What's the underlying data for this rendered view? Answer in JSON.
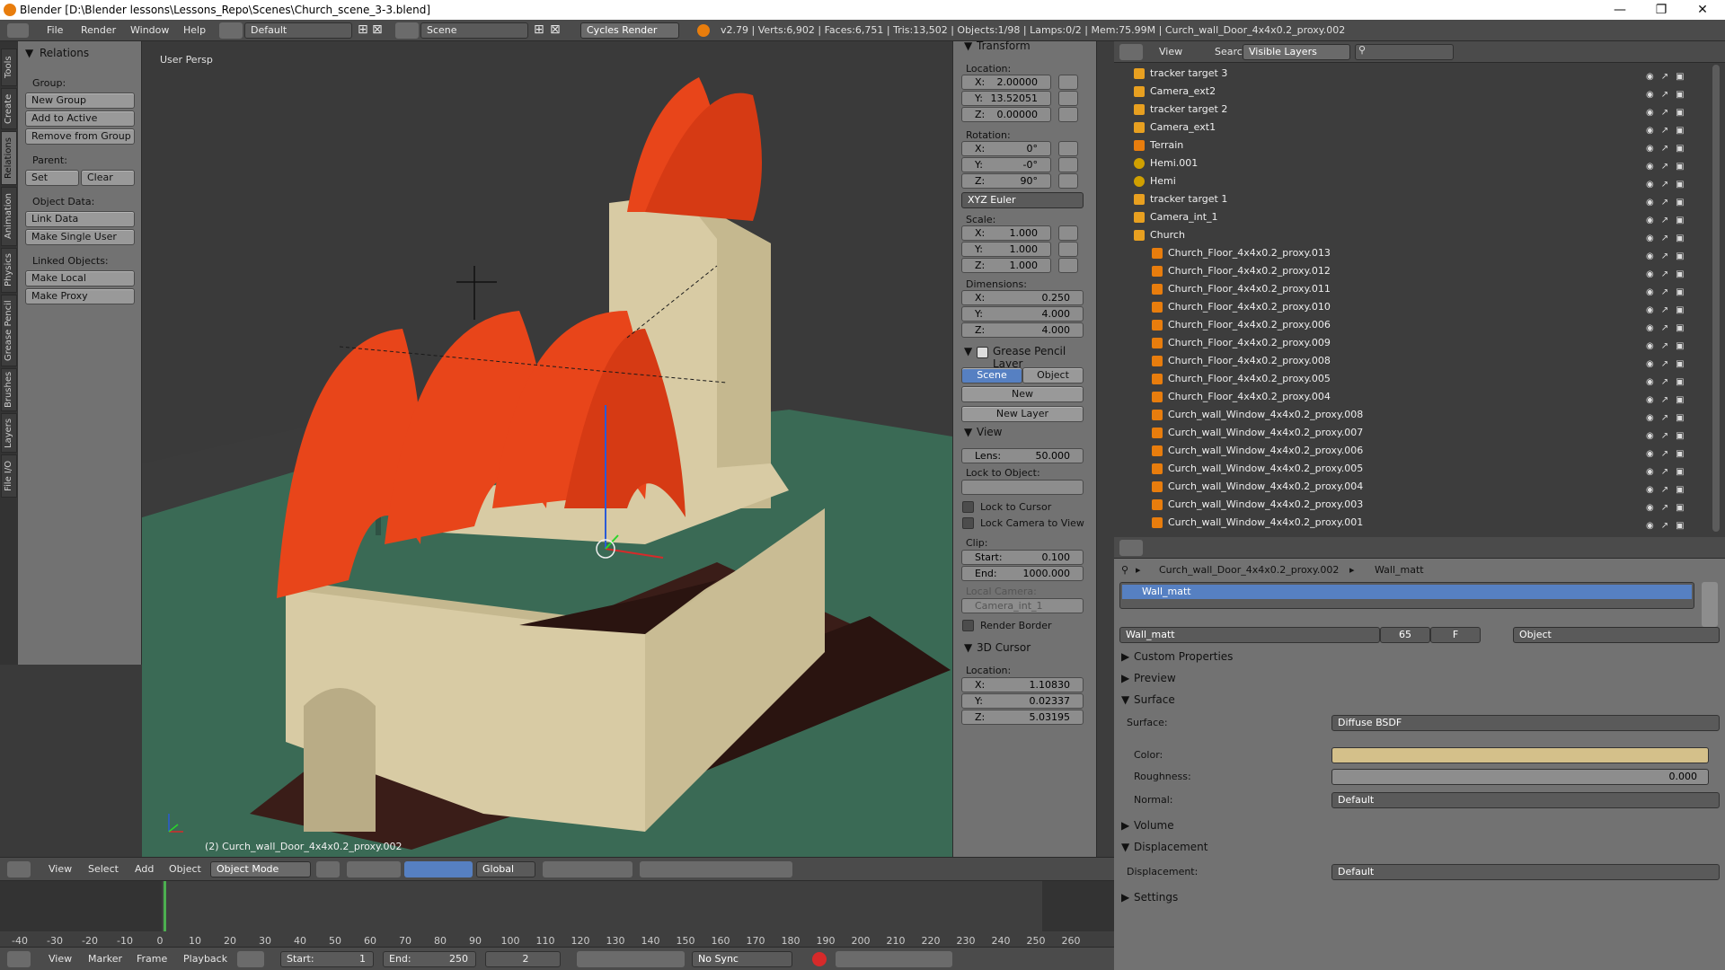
{
  "window": {
    "title": "Blender [D:\\Blender lessons\\Lessons_Repo\\Scenes\\Church_scene_3-3.blend]",
    "controls": [
      "—",
      "❐",
      "✕"
    ]
  },
  "infobar": {
    "menus": [
      "File",
      "Render",
      "Window",
      "Help"
    ],
    "layout": "Default",
    "scene": "Scene",
    "engine": "Cycles Render",
    "stats": "v2.79 | Verts:6,902 | Faces:6,751 | Tris:13,502 | Objects:1/98 | Lamps:0/2 | Mem:75.99M | Curch_wall_Door_4x4x0.2_proxy.002"
  },
  "left_tabs": [
    "Tools",
    "Create",
    "Relations",
    "Animation",
    "Physics",
    "Grease Pencil",
    "Brushes",
    "Layers",
    "File I/O"
  ],
  "toolshelf": {
    "title": "Relations",
    "group_label": "Group:",
    "new_group": "New Group",
    "add_to_active": "Add to Active",
    "remove_from_group": "Remove from Group",
    "parent_label": "Parent:",
    "set": "Set",
    "clear": "Clear",
    "object_data_label": "Object Data:",
    "link_data": "Link Data",
    "make_single_user": "Make Single User",
    "linked_objects_label": "Linked Objects:",
    "make_local": "Make Local",
    "make_proxy": "Make Proxy"
  },
  "viewport": {
    "persp_label": "User Persp",
    "active_object": "(2) Curch_wall_Door_4x4x0.2_proxy.002"
  },
  "npanel": {
    "transform_title": "Transform",
    "location_label": "Location:",
    "location": [
      {
        "k": "X:",
        "v": "2.00000"
      },
      {
        "k": "Y:",
        "v": "13.52051"
      },
      {
        "k": "Z:",
        "v": "0.00000"
      }
    ],
    "rotation_label": "Rotation:",
    "rotation": [
      {
        "k": "X:",
        "v": "0°"
      },
      {
        "k": "Y:",
        "v": "-0°"
      },
      {
        "k": "Z:",
        "v": "90°"
      }
    ],
    "rotation_mode": "XYZ Euler",
    "scale_label": "Scale:",
    "scale": [
      {
        "k": "X:",
        "v": "1.000"
      },
      {
        "k": "Y:",
        "v": "1.000"
      },
      {
        "k": "Z:",
        "v": "1.000"
      }
    ],
    "dimensions_label": "Dimensions:",
    "dimensions": [
      {
        "k": "X:",
        "v": "0.250"
      },
      {
        "k": "Y:",
        "v": "4.000"
      },
      {
        "k": "Z:",
        "v": "4.000"
      }
    ],
    "grease_pencil_title": "Grease Pencil Layer",
    "gp_scene": "Scene",
    "gp_object": "Object",
    "gp_new": "New",
    "gp_new_layer": "New Layer",
    "view_title": "View",
    "lens_label": "Lens:",
    "lens_value": "50.000",
    "lock_to_object_label": "Lock to Object:",
    "lock_to_cursor": "Lock to Cursor",
    "lock_camera_to_view": "Lock Camera to View",
    "clip_label": "Clip:",
    "clip_start_label": "Start:",
    "clip_start": "0.100",
    "clip_end_label": "End:",
    "clip_end": "1000.000",
    "local_camera_label": "Local Camera:",
    "local_camera": "Camera_int_1",
    "render_border": "Render Border",
    "cursor_title": "3D Cursor",
    "cursor_location_label": "Location:",
    "cursor": [
      {
        "k": "X:",
        "v": "1.10830"
      },
      {
        "k": "Y:",
        "v": "0.02337"
      },
      {
        "k": "Z:",
        "v": "5.03195"
      }
    ]
  },
  "outliner": {
    "view": "View",
    "search": "Search",
    "filter": "Visible Layers",
    "rows": [
      {
        "name": "tracker target 3",
        "indent": 0,
        "type": "empty"
      },
      {
        "name": "Camera_ext2",
        "indent": 0,
        "type": "camera"
      },
      {
        "name": "tracker target 2",
        "indent": 0,
        "type": "empty"
      },
      {
        "name": "Camera_ext1",
        "indent": 0,
        "type": "camera"
      },
      {
        "name": "Terrain",
        "indent": 0,
        "type": "mesh"
      },
      {
        "name": "Hemi.001",
        "indent": 0,
        "type": "lamp"
      },
      {
        "name": "Hemi",
        "indent": 0,
        "type": "lamp"
      },
      {
        "name": "tracker target 1",
        "indent": 0,
        "type": "empty"
      },
      {
        "name": "Camera_int_1",
        "indent": 0,
        "type": "camera"
      },
      {
        "name": "Church",
        "indent": 0,
        "type": "empty"
      },
      {
        "name": "Church_Floor_4x4x0.2_proxy.013",
        "indent": 1,
        "type": "mesh"
      },
      {
        "name": "Church_Floor_4x4x0.2_proxy.012",
        "indent": 1,
        "type": "mesh"
      },
      {
        "name": "Church_Floor_4x4x0.2_proxy.011",
        "indent": 1,
        "type": "mesh"
      },
      {
        "name": "Church_Floor_4x4x0.2_proxy.010",
        "indent": 1,
        "type": "mesh"
      },
      {
        "name": "Church_Floor_4x4x0.2_proxy.006",
        "indent": 1,
        "type": "mesh"
      },
      {
        "name": "Church_Floor_4x4x0.2_proxy.009",
        "indent": 1,
        "type": "mesh"
      },
      {
        "name": "Church_Floor_4x4x0.2_proxy.008",
        "indent": 1,
        "type": "mesh"
      },
      {
        "name": "Church_Floor_4x4x0.2_proxy.005",
        "indent": 1,
        "type": "mesh"
      },
      {
        "name": "Church_Floor_4x4x0.2_proxy.004",
        "indent": 1,
        "type": "mesh"
      },
      {
        "name": "Curch_wall_Window_4x4x0.2_proxy.008",
        "indent": 1,
        "type": "mesh"
      },
      {
        "name": "Curch_wall_Window_4x4x0.2_proxy.007",
        "indent": 1,
        "type": "mesh"
      },
      {
        "name": "Curch_wall_Window_4x4x0.2_proxy.006",
        "indent": 1,
        "type": "mesh"
      },
      {
        "name": "Curch_wall_Window_4x4x0.2_proxy.005",
        "indent": 1,
        "type": "mesh"
      },
      {
        "name": "Curch_wall_Window_4x4x0.2_proxy.004",
        "indent": 1,
        "type": "mesh"
      },
      {
        "name": "Curch_wall_Window_4x4x0.2_proxy.003",
        "indent": 1,
        "type": "mesh"
      },
      {
        "name": "Curch_wall_Window_4x4x0.2_proxy.001",
        "indent": 1,
        "type": "mesh"
      }
    ]
  },
  "properties": {
    "breadcrumb_object": "Curch_wall_Door_4x4x0.2_proxy.002",
    "breadcrumb_material": "Wall_matt",
    "slot_name": "Wall_matt",
    "material_name": "Wall_matt",
    "users": "65",
    "fake_user": "F",
    "link": "Object",
    "custom_properties": "Custom Properties",
    "preview": "Preview",
    "surface_title": "Surface",
    "surface_label": "Surface:",
    "surface_value": "Diffuse BSDF",
    "color_label": "Color:",
    "color_value": "#d4c08a",
    "roughness_label": "Roughness:",
    "roughness_value": "0.000",
    "normal_label": "Normal:",
    "normal_value": "Default",
    "volume": "Volume",
    "displacement_title": "Displacement",
    "displacement_label": "Displacement:",
    "displacement_value": "Default",
    "settings": "Settings"
  },
  "viewport_header": {
    "menus": [
      "View",
      "Select",
      "Add",
      "Object"
    ],
    "mode": "Object Mode",
    "orientation": "Global"
  },
  "timeline": {
    "ticks": [
      "-40",
      "-30",
      "-20",
      "-10",
      "0",
      "10",
      "20",
      "30",
      "40",
      "50",
      "60",
      "70",
      "80",
      "90",
      "100",
      "110",
      "120",
      "130",
      "140",
      "150",
      "160",
      "170",
      "180",
      "190",
      "200",
      "210",
      "220",
      "230",
      "240",
      "250",
      "260"
    ],
    "current_frame": "2",
    "menus": [
      "View",
      "Marker",
      "Frame",
      "Playback"
    ],
    "start_label": "Start:",
    "start": "1",
    "end_label": "End:",
    "end": "250",
    "sync": "No Sync"
  },
  "colors": {
    "vault": "#e8451a",
    "wall": "#d8cba4",
    "ground": "#3a6a55",
    "floor": "#3a1d18",
    "selection": "#5680c2"
  }
}
